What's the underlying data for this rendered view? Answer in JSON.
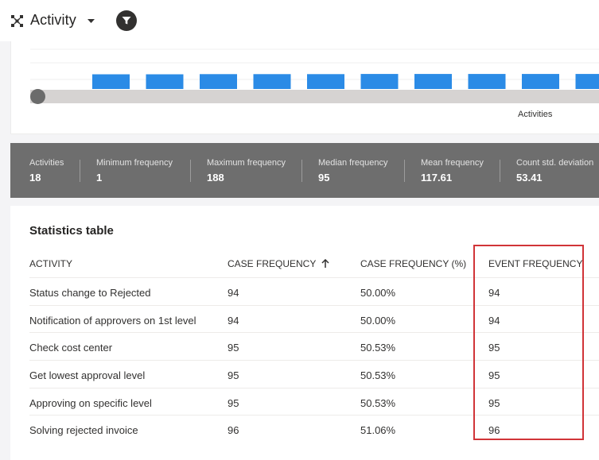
{
  "header": {
    "title": "Activity"
  },
  "chart_data": {
    "type": "bar",
    "xlabel": "Activities",
    "visible_bar_count": 10,
    "values": [
      94,
      94,
      95,
      95,
      95,
      96,
      96,
      96,
      96,
      96
    ],
    "ylim": [
      0,
      188
    ],
    "bar_color": "#2b8be6",
    "grid": true
  },
  "stats": [
    {
      "label": "Activities",
      "value": "18"
    },
    {
      "label": "Minimum frequency",
      "value": "1"
    },
    {
      "label": "Maximum frequency",
      "value": "188"
    },
    {
      "label": "Median frequency",
      "value": "95"
    },
    {
      "label": "Mean frequency",
      "value": "117.61"
    },
    {
      "label": "Count std. deviation",
      "value": "53.41"
    }
  ],
  "table": {
    "title": "Statistics table",
    "columns": [
      "ACTIVITY",
      "CASE FREQUENCY",
      "CASE FREQUENCY (%)",
      "EVENT FREQUENCY"
    ],
    "sort_column": "CASE FREQUENCY",
    "sort_direction": "ascending",
    "rows": [
      [
        "Status change to Rejected",
        "94",
        "50.00%",
        "94"
      ],
      [
        "Notification of approvers on 1st level",
        "94",
        "50.00%",
        "94"
      ],
      [
        "Check cost center",
        "95",
        "50.53%",
        "95"
      ],
      [
        "Get lowest approval level",
        "95",
        "50.53%",
        "95"
      ],
      [
        "Approving on specific level",
        "95",
        "50.53%",
        "95"
      ],
      [
        "Solving rejected invoice",
        "96",
        "51.06%",
        "96"
      ]
    ]
  },
  "colors": {
    "highlight": "#d13438",
    "stats_background": "#6e6e6e",
    "bar": "#2b8be6"
  }
}
